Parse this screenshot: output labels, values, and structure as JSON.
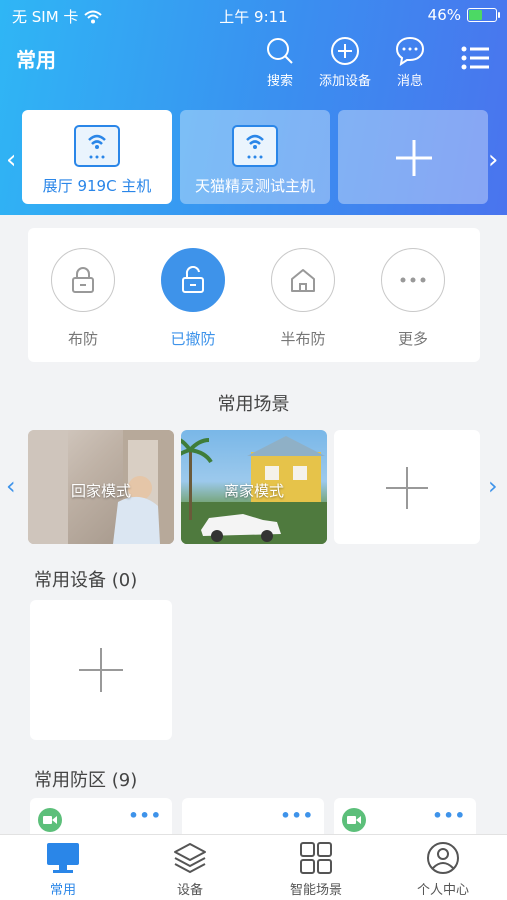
{
  "status_bar": {
    "carrier": "无 SIM 卡",
    "time": "上午 9:11",
    "battery": "46%",
    "battery_level": 0.46
  },
  "header": {
    "title": "常用",
    "actions": [
      {
        "label": "搜索",
        "icon": "search-icon"
      },
      {
        "label": "添加设备",
        "icon": "plus-circle-icon"
      },
      {
        "label": "消息",
        "icon": "message-icon"
      }
    ],
    "menu_icon": "menu-icon"
  },
  "hosts": [
    {
      "label": "展厅 919C 主机",
      "selected": true
    },
    {
      "label": "天猫精灵测试主机",
      "selected": false
    }
  ],
  "arm_modes": [
    {
      "label": "布防",
      "icon": "lock-icon",
      "active": false
    },
    {
      "label": "已撤防",
      "icon": "unlock-icon",
      "active": true
    },
    {
      "label": "半布防",
      "icon": "home-icon",
      "active": false
    },
    {
      "label": "更多",
      "icon": "more-icon",
      "active": false
    }
  ],
  "scenes": {
    "title": "常用场景",
    "items": [
      {
        "label": "回家模式"
      },
      {
        "label": "离家模式"
      }
    ]
  },
  "devices": {
    "title": "常用设备 (0)"
  },
  "zones": {
    "title": "常用防区 (9)"
  },
  "tabbar": {
    "tabs": [
      {
        "label": "常用",
        "icon": "monitor-icon",
        "active": true
      },
      {
        "label": "设备",
        "icon": "layers-icon",
        "active": false
      },
      {
        "label": "智能场景",
        "icon": "grid-icon",
        "active": false
      },
      {
        "label": "个人中心",
        "icon": "user-icon",
        "active": false
      }
    ]
  },
  "colors": {
    "accent": "#3e93ea",
    "header_gradient_start": "#2fb6f5",
    "header_gradient_end": "#4a74ee"
  }
}
